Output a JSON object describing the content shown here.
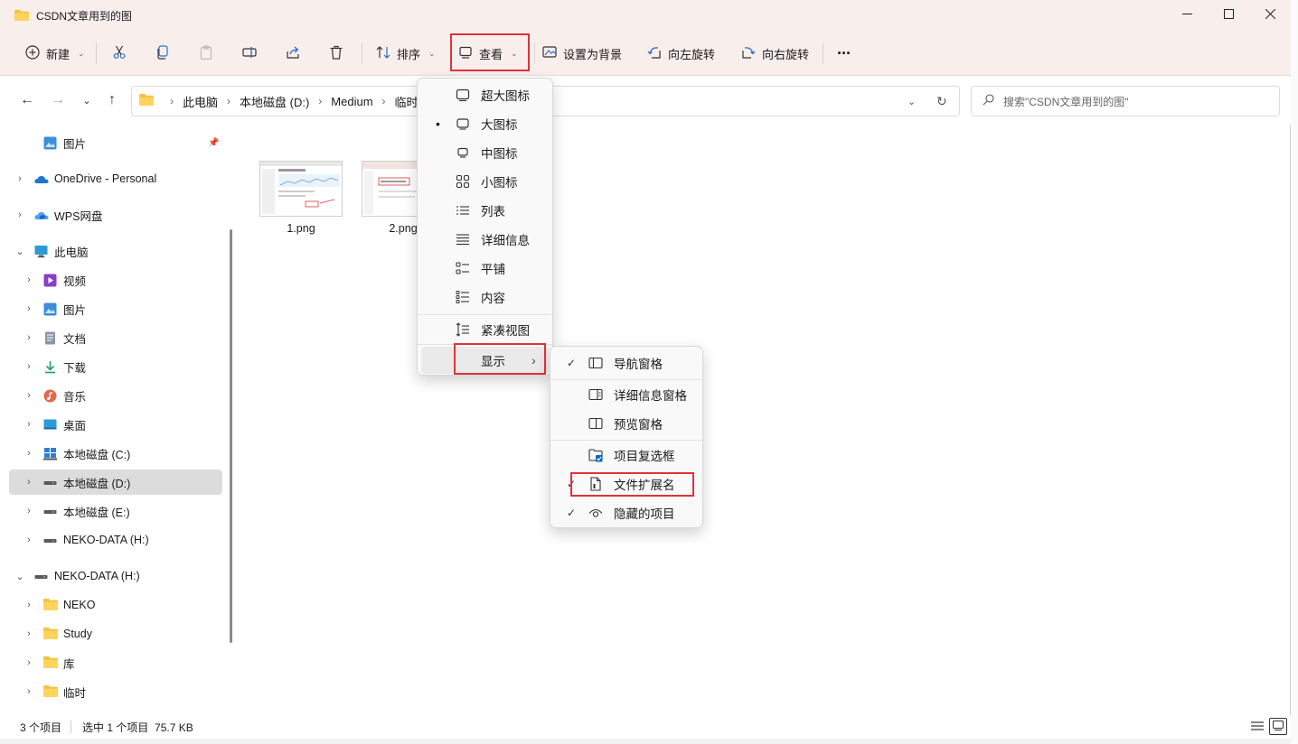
{
  "window": {
    "title": "CSDN文章用到的图",
    "controls": [
      "minimize-icon",
      "maximize-icon",
      "close-icon"
    ]
  },
  "toolbar": {
    "new_label": "新建",
    "sort_label": "排序",
    "view_label": "查看",
    "set_bg_label": "设置为背景",
    "rotate_left_label": "向左旋转",
    "rotate_right_label": "向右旋转",
    "more_label": "···"
  },
  "address": {
    "crumbs": [
      "此电脑",
      "本地磁盘 (D:)",
      "Medium",
      "临时"
    ],
    "search_placeholder": "搜索\"CSDN文章用到的图\""
  },
  "sidebar": {
    "items": [
      {
        "label": "图片",
        "icon": "pictures-icon"
      },
      {
        "label": "OneDrive - Personal",
        "icon": "onedrive-icon"
      },
      {
        "label": "WPS网盘",
        "icon": "wps-cloud-icon"
      },
      {
        "label": "此电脑",
        "icon": "computer-icon"
      },
      {
        "label": "视频",
        "icon": "videos-icon"
      },
      {
        "label": "图片",
        "icon": "pictures-icon"
      },
      {
        "label": "文档",
        "icon": "documents-icon"
      },
      {
        "label": "下载",
        "icon": "downloads-icon"
      },
      {
        "label": "音乐",
        "icon": "music-icon"
      },
      {
        "label": "桌面",
        "icon": "desktop-icon"
      },
      {
        "label": "本地磁盘 (C:)",
        "icon": "windows-drive-icon"
      },
      {
        "label": "本地磁盘 (D:)",
        "icon": "drive-icon"
      },
      {
        "label": "本地磁盘 (E:)",
        "icon": "drive-icon"
      },
      {
        "label": "NEKO-DATA (H:)",
        "icon": "drive-icon"
      },
      {
        "label": "NEKO-DATA (H:)",
        "icon": "drive-icon"
      },
      {
        "label": "NEKO",
        "icon": "folder-icon"
      },
      {
        "label": "Study",
        "icon": "folder-icon"
      },
      {
        "label": "库",
        "icon": "folder-icon"
      },
      {
        "label": "临时",
        "icon": "folder-icon"
      }
    ]
  },
  "files": [
    {
      "name": "1.png"
    },
    {
      "name": "2.png"
    }
  ],
  "view_menu": {
    "items": [
      {
        "label": "超大图标",
        "icon": "extra-large-icons-icon"
      },
      {
        "label": "大图标",
        "icon": "large-icons-icon",
        "selected": true
      },
      {
        "label": "中图标",
        "icon": "medium-icons-icon"
      },
      {
        "label": "小图标",
        "icon": "small-icons-icon"
      },
      {
        "label": "列表",
        "icon": "list-icon"
      },
      {
        "label": "详细信息",
        "icon": "details-icon"
      },
      {
        "label": "平铺",
        "icon": "tiles-icon"
      },
      {
        "label": "内容",
        "icon": "content-icon"
      },
      {
        "label": "紧凑视图",
        "icon": "compact-view-icon"
      },
      {
        "label": "显示",
        "icon": "",
        "submenu": true
      }
    ]
  },
  "show_menu": {
    "items": [
      {
        "label": "导航窗格",
        "icon": "navigation-pane-icon",
        "checked": true
      },
      {
        "label": "详细信息窗格",
        "icon": "details-pane-icon",
        "checked": false
      },
      {
        "label": "预览窗格",
        "icon": "preview-pane-icon",
        "checked": false
      },
      {
        "label": "项目复选框",
        "icon": "item-checkbox-icon",
        "checked": false
      },
      {
        "label": "文件扩展名",
        "icon": "file-extension-icon",
        "checked": true
      },
      {
        "label": "隐藏的项目",
        "icon": "hidden-items-icon",
        "checked": true
      }
    ]
  },
  "status": {
    "count": "3 个项目",
    "selection": "选中 1 个项目  75.7 KB"
  },
  "colors": {
    "highlight": "#e0323a",
    "toolbar_bg": "#f8eeec",
    "folder": "#f4c242",
    "accent": "#0067c0"
  }
}
